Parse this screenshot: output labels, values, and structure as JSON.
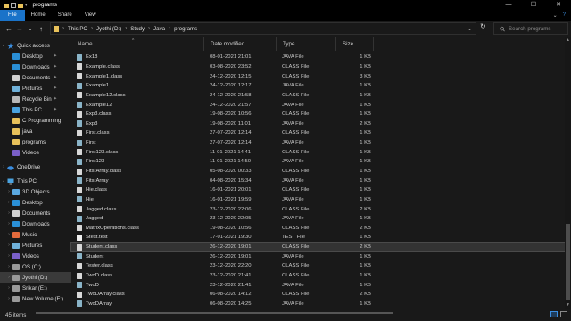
{
  "window": {
    "title": "programs"
  },
  "ribbon": {
    "tabs": [
      "File",
      "Home",
      "Share",
      "View"
    ]
  },
  "nav": {
    "back": "←",
    "forward": "→",
    "recent": "⌄",
    "up": "↑",
    "refresh": "↻"
  },
  "breadcrumb": [
    "This PC",
    "Jyothi (D:)",
    "Study",
    "Java",
    "programs"
  ],
  "search": {
    "placeholder": "Search programs"
  },
  "sidebar": {
    "quick_access": "Quick access",
    "items": [
      {
        "label": "Desktop",
        "icon": "desktop-icon",
        "color": "#2a8fd6",
        "pinned": true,
        "indent": 2
      },
      {
        "label": "Downloads",
        "icon": "downloads-icon",
        "color": "#2a8fd6",
        "pinned": true,
        "indent": 2
      },
      {
        "label": "Documents",
        "icon": "documents-icon",
        "color": "#d0d0d0",
        "pinned": true,
        "indent": 2
      },
      {
        "label": "Pictures",
        "icon": "pictures-icon",
        "color": "#6fb0d8",
        "pinned": true,
        "indent": 2
      },
      {
        "label": "Recycle Bin",
        "icon": "recycle-bin-icon",
        "color": "#b8b8b8",
        "pinned": true,
        "indent": 2
      },
      {
        "label": "This PC",
        "icon": "pc-icon",
        "color": "#4aa3e0",
        "pinned": true,
        "indent": 2
      },
      {
        "label": "C Programming",
        "icon": "folder-icon",
        "color": "#e8c15a",
        "pinned": false,
        "indent": 2
      },
      {
        "label": "java",
        "icon": "folder-icon",
        "color": "#e8c15a",
        "pinned": false,
        "indent": 2
      },
      {
        "label": "programs",
        "icon": "folder-icon",
        "color": "#e8c15a",
        "pinned": false,
        "indent": 2
      },
      {
        "label": "Videos",
        "icon": "videos-icon",
        "color": "#7a5fc8",
        "pinned": false,
        "indent": 2
      }
    ],
    "onedrive": "OneDrive",
    "this_pc": "This PC",
    "pc_items": [
      {
        "label": "3D Objects",
        "icon": "3d-objects-icon",
        "color": "#5aa8e0"
      },
      {
        "label": "Desktop",
        "icon": "desktop-icon",
        "color": "#2a8fd6"
      },
      {
        "label": "Documents",
        "icon": "documents-icon",
        "color": "#d0d0d0"
      },
      {
        "label": "Downloads",
        "icon": "downloads-icon",
        "color": "#2a8fd6"
      },
      {
        "label": "Music",
        "icon": "music-icon",
        "color": "#e36a3c"
      },
      {
        "label": "Pictures",
        "icon": "pictures-icon",
        "color": "#6fb0d8"
      },
      {
        "label": "Videos",
        "icon": "videos-icon",
        "color": "#7a5fc8"
      },
      {
        "label": "OS (C:)",
        "icon": "drive-icon",
        "color": "#9a9a9a"
      },
      {
        "label": "Jyothi (D:)",
        "icon": "drive-icon",
        "color": "#9a9a9a",
        "selected": true
      },
      {
        "label": "Srikar (E:)",
        "icon": "drive-icon",
        "color": "#9a9a9a"
      },
      {
        "label": "New Volume (F:)",
        "icon": "drive-icon",
        "color": "#9a9a9a"
      }
    ]
  },
  "columns": {
    "name": "Name",
    "date": "Date modified",
    "type": "Type",
    "size": "Size"
  },
  "files": [
    {
      "name": "Ex18",
      "date": "08-01-2021 21:01",
      "type": "JAVA File",
      "size": "1 KB",
      "kind": "java"
    },
    {
      "name": "Example.class",
      "date": "03-08-2020 23:52",
      "type": "CLASS File",
      "size": "1 KB",
      "kind": "class"
    },
    {
      "name": "Example1.class",
      "date": "24-12-2020 12:15",
      "type": "CLASS File",
      "size": "3 KB",
      "kind": "class"
    },
    {
      "name": "Example1",
      "date": "24-12-2020 12:17",
      "type": "JAVA File",
      "size": "1 KB",
      "kind": "java"
    },
    {
      "name": "Example12.class",
      "date": "24-12-2020 21:58",
      "type": "CLASS File",
      "size": "1 KB",
      "kind": "class"
    },
    {
      "name": "Example12",
      "date": "24-12-2020 21:57",
      "type": "JAVA File",
      "size": "1 KB",
      "kind": "java"
    },
    {
      "name": "Exp3.class",
      "date": "19-08-2020 10:56",
      "type": "CLASS File",
      "size": "1 KB",
      "kind": "class"
    },
    {
      "name": "Exp3",
      "date": "19-08-2020 11:01",
      "type": "JAVA File",
      "size": "2 KB",
      "kind": "java"
    },
    {
      "name": "First.class",
      "date": "27-07-2020 12:14",
      "type": "CLASS File",
      "size": "1 KB",
      "kind": "class"
    },
    {
      "name": "First",
      "date": "27-07-2020 12:14",
      "type": "JAVA File",
      "size": "1 KB",
      "kind": "java"
    },
    {
      "name": "First123.class",
      "date": "11-01-2021 14:41",
      "type": "CLASS File",
      "size": "1 KB",
      "kind": "class"
    },
    {
      "name": "First123",
      "date": "11-01-2021 14:50",
      "type": "JAVA File",
      "size": "1 KB",
      "kind": "java"
    },
    {
      "name": "FitsrArray.class",
      "date": "05-08-2020 00:33",
      "type": "CLASS File",
      "size": "1 KB",
      "kind": "class"
    },
    {
      "name": "FitsrArray",
      "date": "04-08-2020 15:34",
      "type": "JAVA File",
      "size": "1 KB",
      "kind": "java"
    },
    {
      "name": "Hie.class",
      "date": "16-01-2021 20:01",
      "type": "CLASS File",
      "size": "1 KB",
      "kind": "class"
    },
    {
      "name": "Hie",
      "date": "16-01-2021 19:59",
      "type": "JAVA File",
      "size": "1 KB",
      "kind": "java"
    },
    {
      "name": "Jagged.class",
      "date": "23-12-2020 22:06",
      "type": "CLASS File",
      "size": "2 KB",
      "kind": "class"
    },
    {
      "name": "Jagged",
      "date": "23-12-2020 22:05",
      "type": "JAVA File",
      "size": "1 KB",
      "kind": "java"
    },
    {
      "name": "MatrixOperations.class",
      "date": "19-08-2020 10:56",
      "type": "CLASS File",
      "size": "2 KB",
      "kind": "class"
    },
    {
      "name": "Stest.test",
      "date": "17-01-2021 19:30",
      "type": "TEST File",
      "size": "1 KB",
      "kind": "test"
    },
    {
      "name": "Student.class",
      "date": "26-12-2020 19:01",
      "type": "CLASS File",
      "size": "2 KB",
      "kind": "class",
      "selected": true
    },
    {
      "name": "Student",
      "date": "26-12-2020 19:01",
      "type": "JAVA File",
      "size": "1 KB",
      "kind": "java"
    },
    {
      "name": "Tester.class",
      "date": "23-12-2020 22:20",
      "type": "CLASS File",
      "size": "1 KB",
      "kind": "class"
    },
    {
      "name": "TwoD.class",
      "date": "23-12-2020 21:41",
      "type": "CLASS File",
      "size": "1 KB",
      "kind": "class"
    },
    {
      "name": "TwoD",
      "date": "23-12-2020 21:41",
      "type": "JAVA File",
      "size": "1 KB",
      "kind": "java"
    },
    {
      "name": "TwoDArray.class",
      "date": "06-08-2020 14:12",
      "type": "CLASS File",
      "size": "2 KB",
      "kind": "class"
    },
    {
      "name": "TwoDArray",
      "date": "06-08-2020 14:25",
      "type": "JAVA File",
      "size": "1 KB",
      "kind": "java"
    }
  ],
  "status": {
    "items": "45 items"
  },
  "colors": {
    "accent": "#1a73c9",
    "background": "#191919",
    "folder": "#e8c15a"
  }
}
